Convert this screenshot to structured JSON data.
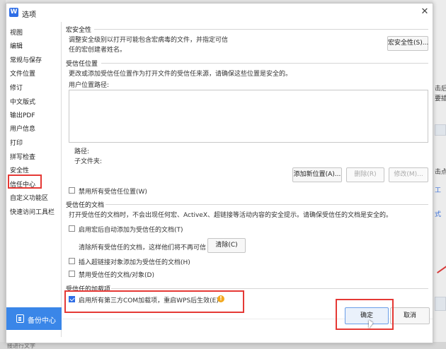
{
  "dialog": {
    "logo_letter": "W",
    "title": "选项",
    "close_glyph": "✕"
  },
  "sidebar": {
    "items": [
      {
        "label": "视图"
      },
      {
        "label": "编辑"
      },
      {
        "label": "常规与保存"
      },
      {
        "label": "文件位置"
      },
      {
        "label": "修订"
      },
      {
        "label": "中文版式"
      },
      {
        "label": "输出PDF"
      },
      {
        "label": "用户信息"
      },
      {
        "label": "打印"
      },
      {
        "label": "拼写检查"
      },
      {
        "label": "安全性"
      },
      {
        "label": "信任中心"
      },
      {
        "label": "自定义功能区"
      },
      {
        "label": "快速访问工具栏"
      }
    ],
    "selected": "信任中心",
    "backup_label": "备份中心",
    "backup_icon": "backup-icon"
  },
  "macro": {
    "title": "宏安全性",
    "desc_line1": "调整安全级别以打开可能包含宏病毒的文件，并指定可信",
    "desc_line2": "任的宏创建者姓名。",
    "button": "宏安全性(S)..."
  },
  "trusted_locations": {
    "title": "受信任位置",
    "desc": "更改或添加受信任位置作为打开文件的受信任来源，请确保这些位置是安全的。",
    "user_path_label": "用户位置路径:",
    "path_label": "路径:",
    "subfolder_label": "子文件夹:",
    "add_button": "添加新位置(A)...",
    "delete_button": "删除(R)",
    "modify_button": "修改(M)...",
    "disable_all_label": "禁用所有受信任位置(W)",
    "disable_all_checked": false
  },
  "trusted_documents": {
    "title": "受信任的文档",
    "desc": "打开受信任的文档时，不会出现任何宏、ActiveX、超链接等活动内容的安全提示。请确保受信任的文档是安全的。",
    "auto_add_label": "启用宏后自动添加为受信任的文档(T)",
    "auto_add_checked": false,
    "clear_desc": "清除所有受信任的文档，这样他们将不再可信",
    "clear_button": "清除(C)",
    "hyperlink_label": "插入超链接对象添加为受信任的文档(H)",
    "hyperlink_checked": false,
    "disable_docs_label": "禁用受信任的文档/对象(D)",
    "disable_docs_checked": false
  },
  "trusted_addins": {
    "title": "受信任的加载项",
    "enable_com_label": "启用所有第三方COM加载项，重启WPS后生效(E)",
    "enable_com_checked": true,
    "warn_glyph": "!"
  },
  "footer": {
    "ok_button": "确定",
    "cancel_button": "取消"
  },
  "background": {
    "right_fragments": [
      "击后",
      "要插",
      "击点",
      "工",
      "式"
    ],
    "bottom_fragment": "接进行文字"
  },
  "colors": {
    "accent": "#2f6ee6",
    "backup_bg": "#3a86e8",
    "highlight_red": "#e53935",
    "warning": "#f2a81e"
  }
}
